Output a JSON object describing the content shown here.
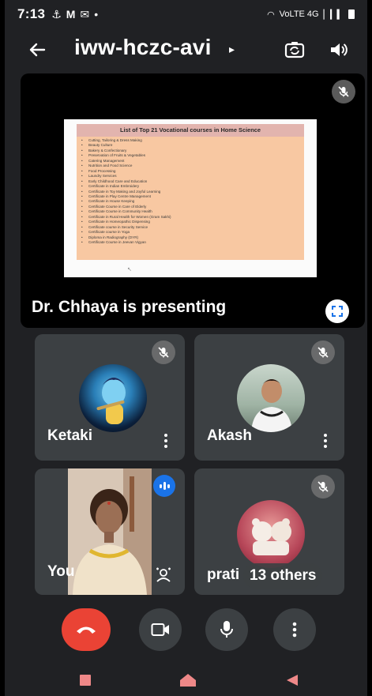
{
  "status_bar": {
    "time": "7:13",
    "left_icons": [
      "torch-icon",
      "gmail-icon",
      "message-icon"
    ],
    "signal_text": "VoLTE 4G"
  },
  "toolbar": {
    "meeting_code": "iww-hczc-avi",
    "code_arrow": "▸"
  },
  "presentation": {
    "slide_title": "List of Top 21 Vocational courses in Home Science",
    "slide_items": [
      "Cutting, Tailoring & Dress Making",
      "Beauty Culture",
      "Bakery & Confectionary",
      "Preservation of Fruits & Vegetables",
      "Catering Management",
      "Nutrition and Food Science",
      "Food Processing",
      "Laundry Services",
      "Early Childhood Care and Education",
      "Certificate in Indian Embroidery",
      "Certificate in Toy Making and Joyful Learning",
      "Certificate in Play Centre Management",
      "Certificate in House Keeping",
      "Certificate Course in Care of Elderly",
      "Certificate Course in Community Health",
      "Certificate in Rural Health for Women (Gram Sakhi)",
      "Certificate in Homeopathic Dispensing",
      "Certificate course in Security Service",
      "Certificate course in Yoga",
      "Diploma in Radiography (DYR)",
      "Certificate Course in Jeevan Vigyan"
    ],
    "presenter_label": "Dr. Chhaya is presenting"
  },
  "participants": {
    "ketaki": {
      "name": "Ketaki"
    },
    "akash": {
      "name": "Akash"
    },
    "you": {
      "name": "You"
    },
    "others": {
      "name": "prati",
      "count_label": "13 others"
    }
  },
  "colors": {
    "background": "#202124",
    "tile": "#3c4043",
    "end_call": "#ea4335",
    "speaking": "#1a73e8",
    "slide_body": "#f8c8a2",
    "slide_header": "#e2b4ae"
  }
}
